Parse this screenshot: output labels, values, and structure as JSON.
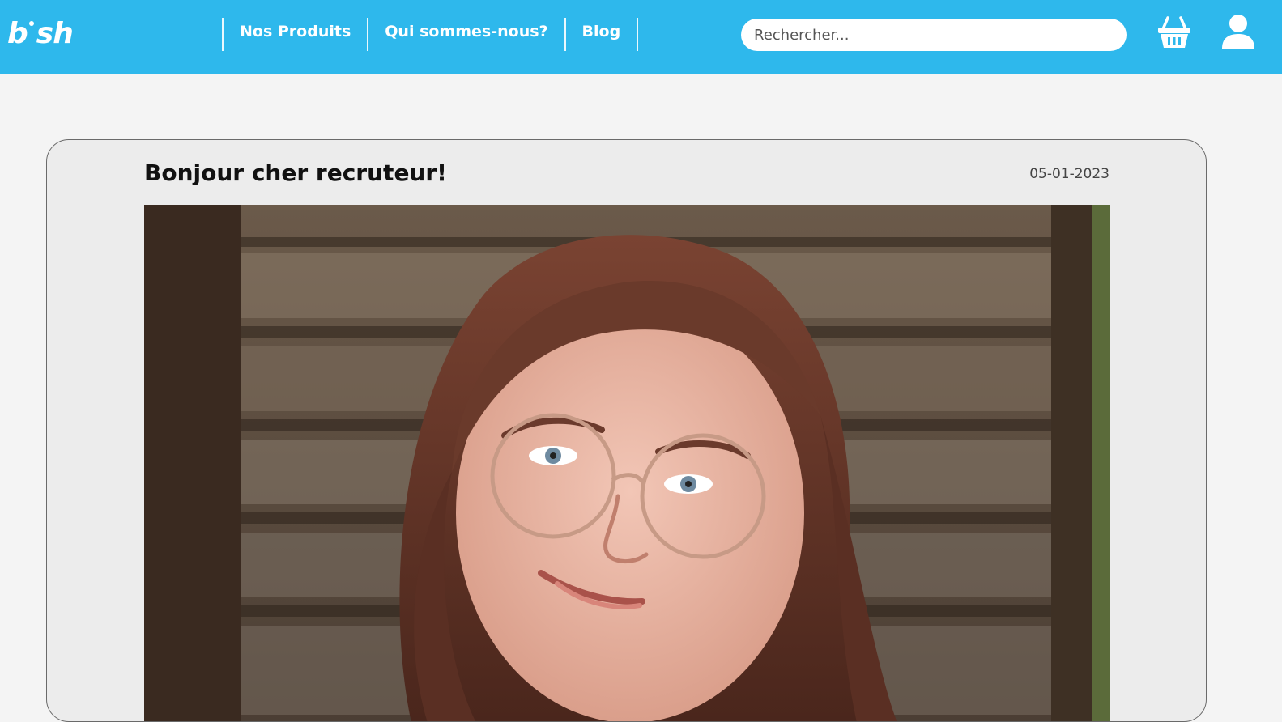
{
  "header": {
    "brand": {
      "letters_left": "b",
      "letters_right": "sh"
    },
    "nav": [
      {
        "label": "Nos Produits"
      },
      {
        "label": "Qui sommes-nous?"
      },
      {
        "label": "Blog"
      }
    ],
    "search": {
      "placeholder": "Rechercher..."
    },
    "icons": {
      "cart": "basket-icon",
      "account": "user-icon"
    },
    "colors": {
      "bar": "#2eb8ec",
      "page_bg": "#f4f4f4",
      "card_bg": "#ececec"
    }
  },
  "post": {
    "title": "Bonjour cher recruteur!",
    "date": "05-01-2023",
    "image": {
      "subject": "portrait-photo"
    }
  }
}
